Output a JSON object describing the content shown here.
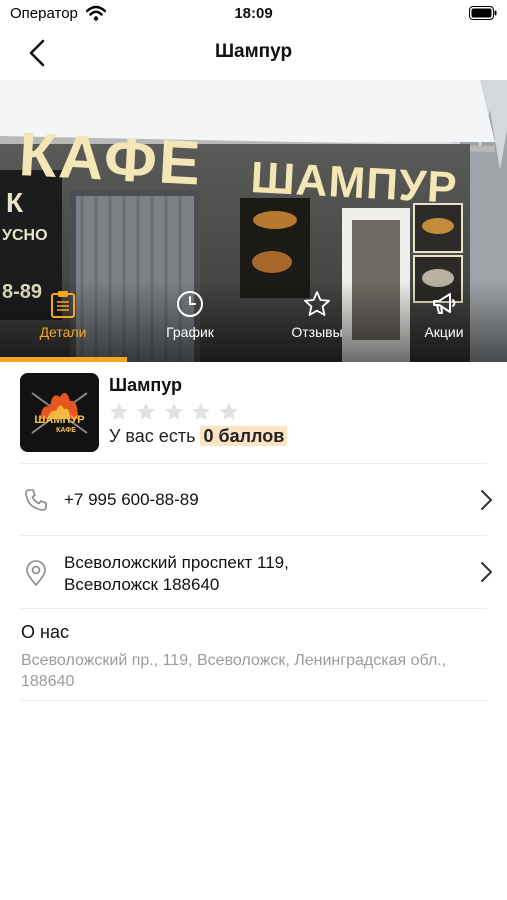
{
  "status_bar": {
    "carrier": "Оператор",
    "time": "18:09"
  },
  "nav": {
    "title": "Шампур",
    "back_icon": "chevron-left-icon"
  },
  "hero": {
    "sign_text": "КАФЕ ШАМПУР",
    "tabs": [
      {
        "label": "Детали",
        "icon": "clipboard-icon",
        "active": true
      },
      {
        "label": "График",
        "icon": "clock-icon",
        "active": false
      },
      {
        "label": "Отзывы",
        "icon": "star-icon",
        "active": false
      },
      {
        "label": "Акции",
        "icon": "megaphone-icon",
        "active": false
      }
    ]
  },
  "shop": {
    "name": "Шампур",
    "logo_text": "ШАМПУР",
    "logo_subtext": "КАФЕ",
    "rating": 0,
    "rating_max": 5,
    "points_prefix": "У вас есть",
    "points_value": "0 баллов"
  },
  "contacts": {
    "phone": "+7 995 600-88-89",
    "address_line1": "Всеволожский проспект 119,",
    "address_line2": "Всеволожск 188640"
  },
  "about": {
    "title": "О нас",
    "text": "Всеволожский пр., 119, Всеволожск, Ленинградская обл., 188640"
  },
  "colors": {
    "accent": "#f6a623",
    "highlight": "#fde5c4",
    "muted_text": "#9b9b9b"
  }
}
